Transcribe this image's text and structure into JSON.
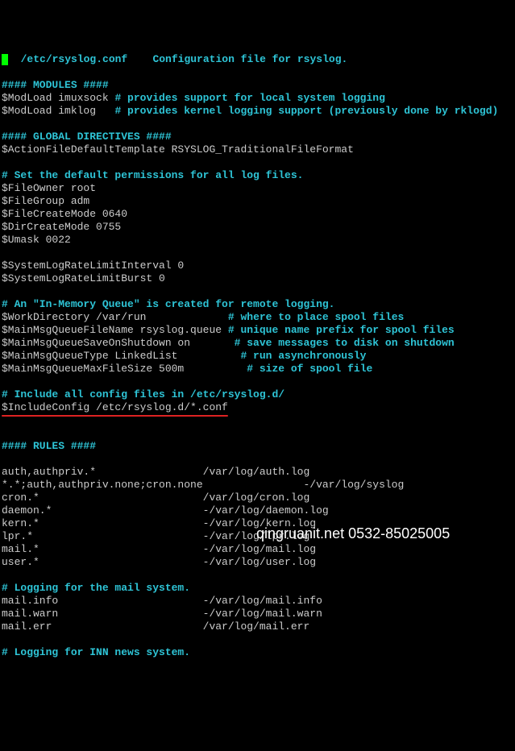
{
  "header": {
    "path": "/etc/rsyslog.conf",
    "desc": "Configuration file for rsyslog."
  },
  "sections": {
    "modules_header": "#### MODULES ####",
    "mod1": "$ModLoad imuxsock",
    "mod1c": "# provides support for local system logging",
    "mod2": "$ModLoad imklog",
    "mod2c": "# provides kernel logging support (previously done by rklogd)",
    "global_header": "#### GLOBAL DIRECTIVES ####",
    "template": "$ActionFileDefaultTemplate RSYSLOG_TraditionalFileFormat",
    "perm_comment": "# Set the default permissions for all log files.",
    "fileowner": "$FileOwner root",
    "filegroup": "$FileGroup adm",
    "filecreate": "$FileCreateMode 0640",
    "dircreate": "$DirCreateMode 0755",
    "umask": "$Umask 0022",
    "ratelimit1": "$SystemLogRateLimitInterval 0",
    "ratelimit2": "$SystemLogRateLimitBurst 0",
    "queue_comment": "# An \"In-Memory Queue\" is created for remote logging.",
    "workdir": "$WorkDirectory /var/run",
    "workdir_c": "# where to place spool files",
    "qfile": "$MainMsgQueueFileName rsyslog.queue",
    "qfile_c": "# unique name prefix for spool files",
    "qsave": "$MainMsgQueueSaveOnShutdown on",
    "qsave_c": "# save messages to disk on shutdown",
    "qtype": "$MainMsgQueueType LinkedList",
    "qtype_c": "# run asynchronously",
    "qsize": "$MainMsgQueueMaxFileSize 500m",
    "qsize_c": "# size of spool file",
    "include_comment": "# Include all config files in /etc/rsyslog.d/",
    "include": "$IncludeConfig /etc/rsyslog.d/*.conf",
    "rules_header": "#### RULES ####",
    "r_auth": "auth,authpriv.*                 /var/log/auth.log",
    "r_syslog": "*.*;auth,authpriv.none;cron.none                -/var/log/syslog",
    "r_cron": "cron.*                          /var/log/cron.log",
    "r_daemon": "daemon.*                        -/var/log/daemon.log",
    "r_kern": "kern.*                          -/var/log/kern.log",
    "r_lpr": "lpr.*                           -/var/log/lpr.log",
    "r_mail": "mail.*                          -/var/log/mail.log",
    "r_user": "user.*                          -/var/log/user.log",
    "mail_comment": "# Logging for the mail system.",
    "m_info": "mail.info                       -/var/log/mail.info",
    "m_warn": "mail.warn                       -/var/log/mail.warn",
    "m_err": "mail.err                        /var/log/mail.err",
    "inn_comment": "# Logging for INN news system."
  },
  "watermark": "qingruanit.net 0532-85025005"
}
